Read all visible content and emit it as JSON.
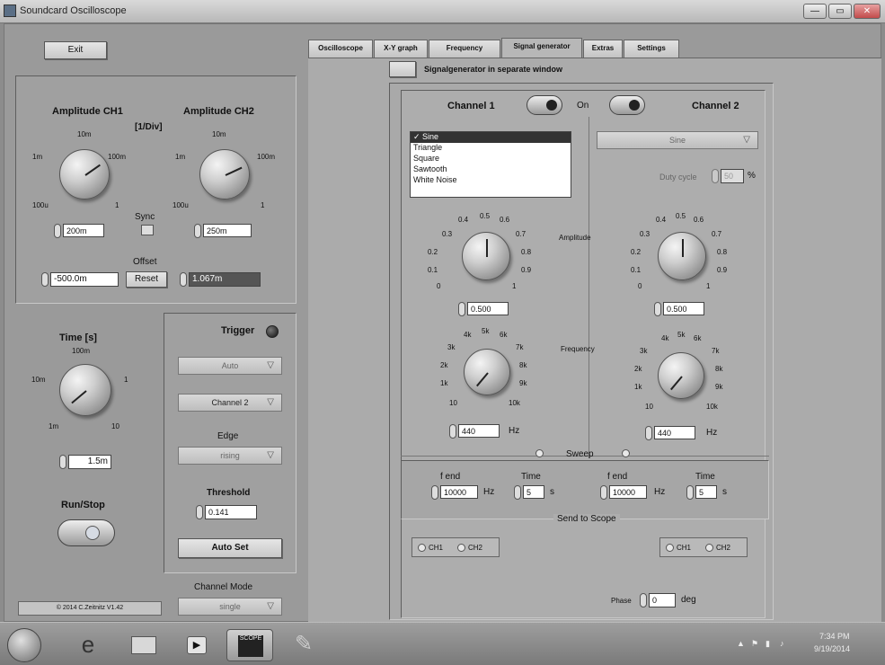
{
  "window": {
    "title": "Soundcard Oscilloscope",
    "controls": [
      "—",
      "▭",
      "✕"
    ]
  },
  "left": {
    "exit_label": "Exit",
    "amplitude": {
      "ch1_title": "Amplitude CH1",
      "ch2_title": "Amplitude CH2",
      "unit": "[1/Div]",
      "ch1_scale": [
        "10m",
        "1m",
        "100m",
        "100u",
        "1"
      ],
      "ch2_scale": [
        "10m",
        "1m",
        "100m",
        "100u",
        "1"
      ],
      "ch1_value": "200m",
      "ch2_value": "250m",
      "sync_label": "Sync",
      "offset_label": "Offset",
      "offset_ch1": "-500.0m",
      "reset_label": "Reset",
      "offset_ch2": "1.067m"
    },
    "time": {
      "title": "Time [s]",
      "scale": [
        "100m",
        "10m",
        "1",
        "1m",
        "10"
      ],
      "value": "1.5m"
    },
    "runstop_label": "Run/Stop",
    "trigger": {
      "title": "Trigger",
      "mode": "Auto",
      "source": "Channel 2",
      "edge_label": "Edge",
      "edge": "rising",
      "threshold_label": "Threshold",
      "threshold": "0.141",
      "autoset_label": "Auto Set"
    },
    "channel_mode_label": "Channel Mode",
    "channel_mode": "single",
    "copyright": "© 2014 C.Zeitnitz V1.42"
  },
  "tabs": [
    "Oscilloscope",
    "X-Y graph",
    "Frequency",
    "Signal generator",
    "Extras",
    "Settings"
  ],
  "active_tab": "Signal generator",
  "siggen": {
    "separate_window_label": "Signalgenerator in separate window",
    "ch1_title": "Channel 1",
    "ch2_title": "Channel 2",
    "on_label": "On",
    "waveforms": [
      "✓ Sine",
      "Triangle",
      "Square",
      "Sawtooth",
      "White Noise"
    ],
    "ch2_waveform": "Sine",
    "duty_cycle_label": "Duty cycle",
    "duty_cycle_value": "50",
    "duty_unit": "%",
    "amplitude_label": "Amplitude",
    "amp_scale": [
      "0.4",
      "0.5",
      "0.6",
      "0.3",
      "0.7",
      "0.2",
      "0.8",
      "0.1",
      "0.9",
      "0",
      "1"
    ],
    "ch1_amplitude": "0.500",
    "ch2_amplitude": "0.500",
    "frequency_label": "Frequency",
    "freq_scale": [
      "4k",
      "5k",
      "6k",
      "3k",
      "7k",
      "2k",
      "8k",
      "1k",
      "9k",
      "10",
      "10k"
    ],
    "ch1_freq": "440",
    "ch2_freq": "440",
    "hz": "Hz",
    "sweep_label": "Sweep",
    "fend_label": "f end",
    "time_label": "Time",
    "ch1_fend": "10000",
    "ch2_fend": "10000",
    "ch1_time": "5",
    "ch2_time": "5",
    "s": "s",
    "send_label": "Send to Scope",
    "ch1": "CH1",
    "ch2": "CH2",
    "phase_label": "Phase",
    "phase_value": "0",
    "phase_unit": "deg"
  },
  "taskbar": {
    "time": "7:34 PM",
    "date": "9/19/2014",
    "scope_label": "SCOPE"
  }
}
